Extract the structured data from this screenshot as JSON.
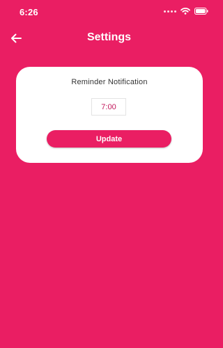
{
  "status_bar": {
    "time": "6:26",
    "icons": [
      "signal-dots-icon",
      "wifi-icon",
      "battery-icon"
    ]
  },
  "app_bar": {
    "title": "Settings",
    "back_icon": "back-arrow-icon"
  },
  "reminder_card": {
    "label": "Reminder Notification",
    "time_value": "7:00",
    "update_label": "Update"
  },
  "colors": {
    "primary": "#ea1e63",
    "card_background": "#ffffff",
    "time_text": "#c2185b"
  }
}
